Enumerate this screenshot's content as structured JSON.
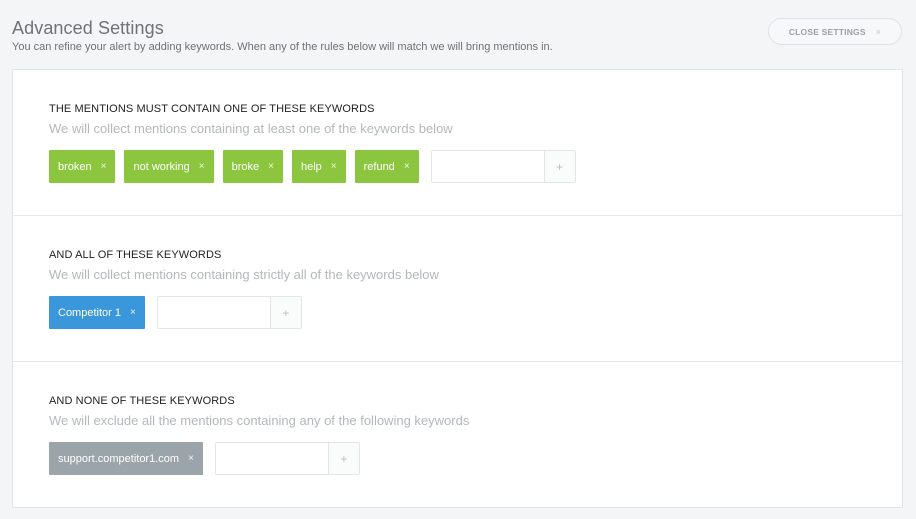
{
  "header": {
    "title": "Advanced Settings",
    "description": "You can refine your alert by adding keywords. When any of the rules below will match we will bring mentions in.",
    "close_label": "CLOSE SETTINGS",
    "close_icon": "×"
  },
  "sections": [
    {
      "title": "THE MENTIONS MUST CONTAIN ONE OF THESE KEYWORDS",
      "subtitle": "We will collect mentions containing at least one of the keywords below",
      "tag_color": "#8cc63f",
      "tags": [
        "broken",
        "not working",
        "broke",
        "help",
        "refund"
      ],
      "input_value": "",
      "add_label": "+"
    },
    {
      "title": "AND ALL OF THESE KEYWORDS",
      "subtitle": "We will collect mentions containing strictly all of the keywords below",
      "tag_color": "#3a97db",
      "tags": [
        "Competitor 1"
      ],
      "input_value": "",
      "add_label": "+"
    },
    {
      "title": "AND NONE OF THESE KEYWORDS",
      "subtitle": "We will exclude all the mentions containing any of the following keywords",
      "tag_color": "#9ba4a8",
      "tags": [
        "support.competitor1.com"
      ],
      "input_value": "",
      "add_label": "+"
    }
  ],
  "tag_remove_icon": "×"
}
